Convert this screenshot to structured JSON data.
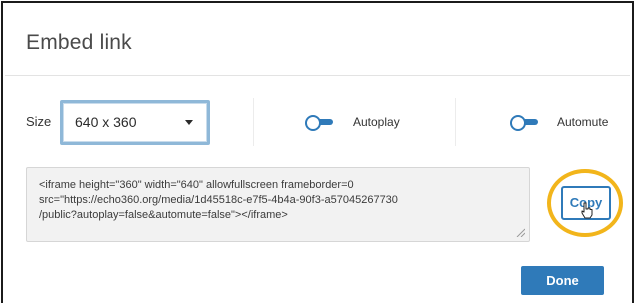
{
  "dialog": {
    "title": "Embed link"
  },
  "size": {
    "label": "Size",
    "selected": "640 x 360"
  },
  "toggles": {
    "autoplay_label": "Autoplay",
    "automute_label": "Automute"
  },
  "embed_code": {
    "lines": [
      "<iframe height=\"360\" width=\"640\" allowfullscreen frameborder=0",
      "src=\"https://echo360.org/media/1d45518c-e7f5-4b4a-90f3-a57045267730",
      "/public?autoplay=false&automute=false\"></iframe>"
    ]
  },
  "buttons": {
    "copy_label": "Copy",
    "done_label": "Done"
  },
  "colors": {
    "accent": "#2f7ab9",
    "highlight_ring": "#f2b51b"
  }
}
